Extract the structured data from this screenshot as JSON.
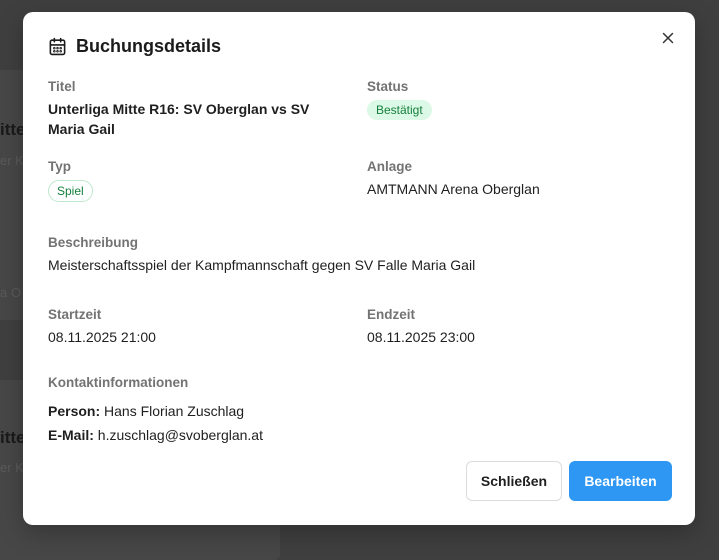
{
  "dialog": {
    "title": "Buchungsdetails",
    "fields": {
      "titel": {
        "label": "Titel",
        "value": "Unterliga Mitte R16: SV Oberglan vs SV Maria Gail"
      },
      "status": {
        "label": "Status",
        "value": "Bestätigt"
      },
      "typ": {
        "label": "Typ",
        "value": "Spiel"
      },
      "anlage": {
        "label": "Anlage",
        "value": "AMTMANN Arena Oberglan"
      },
      "beschreibung": {
        "label": "Beschreibung",
        "value": "Meisterschaftsspiel der Kampfmannschaft gegen SV Falle Maria Gail"
      },
      "startzeit": {
        "label": "Startzeit",
        "value": "08.11.2025 21:00"
      },
      "endzeit": {
        "label": "Endzeit",
        "value": "08.11.2025 23:00"
      }
    },
    "contact": {
      "label": "Kontaktinformationen",
      "person_label": "Person:",
      "person": "Hans Florian Zuschlag",
      "email_label": "E-Mail:",
      "email": "h.zuschlag@svoberglan.at"
    },
    "buttons": {
      "close": "Schließen",
      "edit": "Bearbeiten"
    }
  },
  "icons": {
    "header": "calendar-icon",
    "close": "close-icon"
  },
  "colors": {
    "primary": "#2d97f3",
    "status_bg": "#dcf8e6",
    "status_text": "#15803d",
    "overlay": "#3f3f3f"
  }
}
